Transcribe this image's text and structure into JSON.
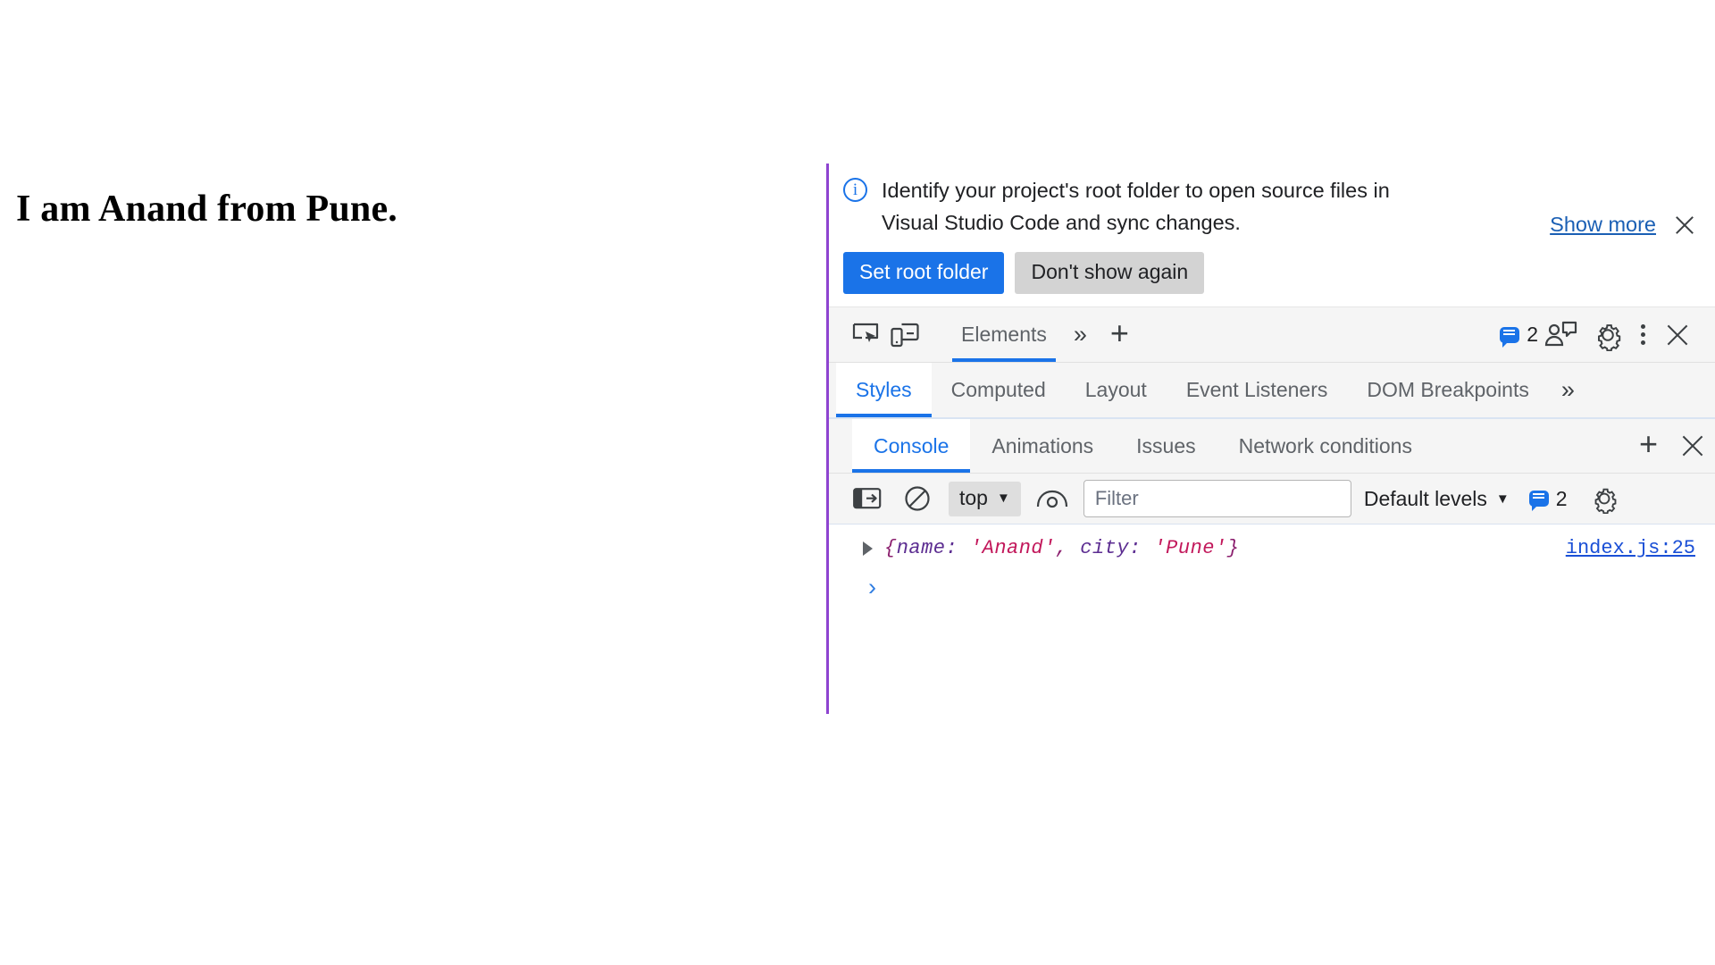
{
  "page": {
    "heading": "I am Anand from Pune."
  },
  "devtools": {
    "banner": {
      "icon": "info-circle-icon",
      "message_line1": "Identify your project's root folder to open source files in",
      "message_line2": "Visual Studio Code and sync changes.",
      "primary_button": "Set root folder",
      "secondary_button": "Don't show again",
      "show_more_link": "Show more",
      "close_icon": "close-icon",
      "accent_color": "#1a73e8",
      "panel_border_color": "#8e44d0"
    },
    "main_toolbar": {
      "inspect_icon": "inspect-element-icon",
      "device_toolbar_icon": "device-toolbar-icon",
      "tabs": [
        {
          "label": "Elements",
          "active": true
        }
      ],
      "more_tabs_icon": "chevron-double-right-icon",
      "add_tab_icon": "plus-icon",
      "issues_count": "2",
      "issues_icon": "message-bubble-icon",
      "ai_assistant_icon": "ai-assistant-icon",
      "settings_icon": "gear-icon",
      "more_options_icon": "dots-vertical-icon",
      "close_icon": "close-icon"
    },
    "pane_tabs": {
      "items": [
        {
          "label": "Styles",
          "active": true
        },
        {
          "label": "Computed",
          "active": false
        },
        {
          "label": "Layout",
          "active": false
        },
        {
          "label": "Event Listeners",
          "active": false
        },
        {
          "label": "DOM Breakpoints",
          "active": false
        }
      ],
      "overflow_icon": "chevron-double-right-icon"
    },
    "drawer_tabs": {
      "items": [
        {
          "label": "Console",
          "active": true
        },
        {
          "label": "Animations",
          "active": false
        },
        {
          "label": "Issues",
          "active": false
        },
        {
          "label": "Network conditions",
          "active": false
        }
      ],
      "add_icon": "plus-icon",
      "close_icon": "close-icon"
    },
    "console_toolbar": {
      "sidebar_toggle_icon": "console-sidebar-icon",
      "clear_console_icon": "clear-console-icon",
      "context_value": "top",
      "context_caret": "▼",
      "live_expression_icon": "eye-icon",
      "filter_placeholder": "Filter",
      "filter_value": "",
      "levels_value": "Default levels",
      "levels_caret": "▼",
      "issues_icon": "message-bubble-icon",
      "issues_count": "2",
      "settings_icon": "gear-icon"
    },
    "console_output": {
      "rows": [
        {
          "expander_icon": "triangle-right-icon",
          "open_brace": "{",
          "key1": "name:",
          "val1": "'Anand'",
          "comma": ",",
          "key2": "city:",
          "val2": "'Pune'",
          "close_brace": "}",
          "source": "index.js:25"
        }
      ],
      "prompt": "›"
    }
  }
}
